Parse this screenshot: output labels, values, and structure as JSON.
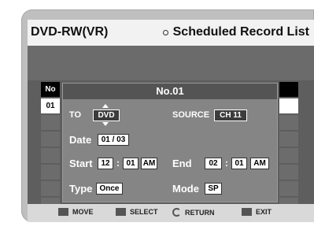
{
  "header": {
    "title": "DVD-RW(VR)",
    "list_title": "Scheduled Record List"
  },
  "list": {
    "no_header": "No",
    "selected_slot": "01"
  },
  "dialog": {
    "title": "No.01",
    "to_label": "TO",
    "to_value": "DVD",
    "source_label": "SOURCE",
    "source_value": "CH 11",
    "date_label": "Date",
    "date_value": "01 / 03",
    "start_label": "Start",
    "start_hour": "12",
    "start_min": "01",
    "start_ampm": "AM",
    "end_label": "End",
    "end_hour": "02",
    "end_min": "01",
    "end_ampm": "AM",
    "type_label": "Type",
    "type_value": "Once",
    "mode_label": "Mode",
    "mode_value": "SP",
    "colon": ":"
  },
  "nav": {
    "move": "MOVE",
    "select": "SELECT",
    "return": "RETURN",
    "exit": "EXIT"
  }
}
